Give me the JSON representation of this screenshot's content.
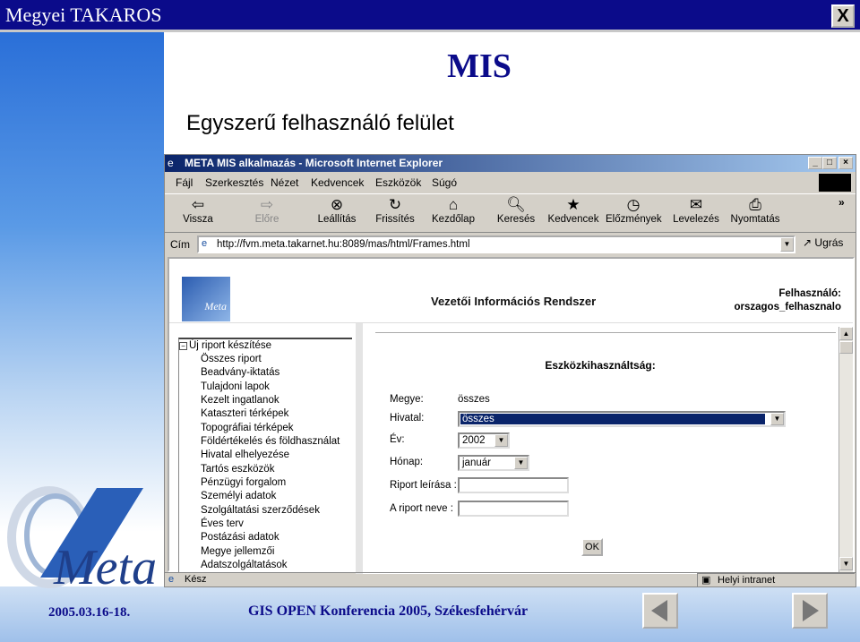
{
  "slide": {
    "title": "Megyei TAKAROS",
    "close_label": "X",
    "heading": "MIS",
    "subtitle": "Egyszerű felhasználó felület",
    "footer_date": "2005.03.16-18.",
    "footer_conference": "GIS OPEN Konferencia 2005, Székesfehérvár",
    "logo_text": "Meta"
  },
  "browser": {
    "title": "META MIS alkalmazás - Microsoft Internet Explorer",
    "menu": [
      "Fájl",
      "Szerkesztés",
      "Nézet",
      "Kedvencek",
      "Eszközök",
      "Súgó"
    ],
    "toolbar": [
      "Vissza",
      "Előre",
      "Leállítás",
      "Frissítés",
      "Kezdőlap",
      "Keresés",
      "Kedvencek",
      "Előzmények",
      "Levelezés",
      "Nyomtatás"
    ],
    "address_label": "Cím",
    "address_value": "http://fvm.meta.takarnet.hu:8089/mas/html/Frames.html",
    "go_label": "Ugrás",
    "status_left": "Kész",
    "status_right": "Helyi intranet"
  },
  "app": {
    "logo_text": "Meta",
    "title": "Vezetői Információs Rendszer",
    "user_label": "Felhasználó:",
    "user_name": "orszagos_felhasznalo",
    "tree_root": "Új riport készítése",
    "tree_items": [
      "Összes riport",
      "Beadvány-iktatás",
      "Tulajdoni lapok",
      "Kezelt ingatlanok",
      "Kataszteri térképek",
      "Topográfiai térképek",
      "Földértékelés és földhasználat",
      "Hivatal elhelyezése",
      "Tartós eszközök",
      "Pénzügyi forgalom",
      "Személyi adatok",
      "Szolgáltatási szerződések",
      "Éves terv",
      "Postázási adatok",
      "Megye jellemzői",
      "Adatszolgáltatások"
    ],
    "form_title": "Eszközkihasználtság:",
    "megye_label": "Megye:",
    "megye_value": "összes",
    "hivatal_label": "Hivatal:",
    "hivatal_value": "összes",
    "ev_label": "Év:",
    "ev_value": "2002",
    "honap_label": "Hónap:",
    "honap_value": "január",
    "leiras_label": "Riport leírása :",
    "nev_label": "A riport neve :",
    "ok_label": "OK"
  }
}
